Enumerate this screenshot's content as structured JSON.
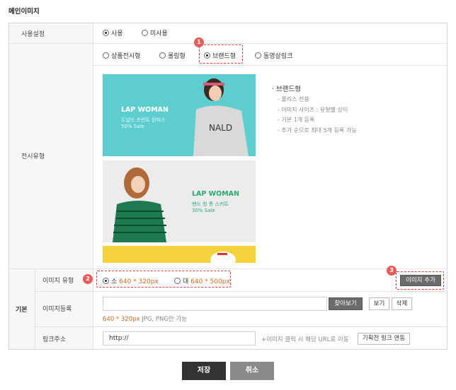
{
  "title": "메인이미지",
  "rows": {
    "usage": {
      "label": "사용설정",
      "options": [
        {
          "label": "사용",
          "selected": true
        },
        {
          "label": "미사용",
          "selected": false
        }
      ]
    },
    "display_type": {
      "label": "전시유형",
      "options": [
        {
          "label": "상품전시형",
          "selected": false
        },
        {
          "label": "롤링형",
          "selected": false
        },
        {
          "label": "브랜드형",
          "selected": true
        },
        {
          "label": "동영상링크",
          "selected": false
        }
      ]
    },
    "basic_group_label": "기본",
    "image_type": {
      "label": "이미지 유형",
      "options": [
        {
          "prefix": "소",
          "size": "640 * 320px",
          "selected": true
        },
        {
          "prefix": "대",
          "size": "640 * 500px",
          "selected": false
        }
      ],
      "add_button": "이미지 추가"
    },
    "image_register": {
      "label": "이미지등록",
      "input_value": "",
      "find_button": "찾아보기",
      "view_button": "보기",
      "delete_button": "삭제",
      "hint_size": "640 * 320px",
      "hint_rest": " JPG, PNG만 가능"
    },
    "link": {
      "label": "링크주소",
      "input_value": "http://",
      "hint": "+이미지 클릭 시 해당 URL로 이동",
      "button": "기획전 링크 연동"
    }
  },
  "preview": {
    "banner1": {
      "title": "LAP WOMAN",
      "sub1": "도날드 프린트 원피스",
      "sub2": "50% Sale",
      "bg": "#5dcdd0"
    },
    "banner2": {
      "title": "LAP WOMAN",
      "sub1": "밴드 청 롱 스커트",
      "sub2": "30% Sale",
      "bg": "#ececec"
    },
    "banner3": {
      "bg": "#f4d23b"
    }
  },
  "description": {
    "heading": "· 브랜드형",
    "lines": [
      "- 풀리스 전용",
      "- 이미지 사이즈 : 유형별 상이",
      "- 기본 1개 등록",
      "- 추가 순으로 최대 5개 등록 가능"
    ]
  },
  "markers": [
    "1",
    "2",
    "3"
  ],
  "footer": {
    "save": "저장",
    "cancel": "취소"
  },
  "colors": {
    "accent": "#e23b3b",
    "size_text": "#d2691e",
    "save_bg": "#333333",
    "cancel_bg": "#8a8a8a"
  }
}
